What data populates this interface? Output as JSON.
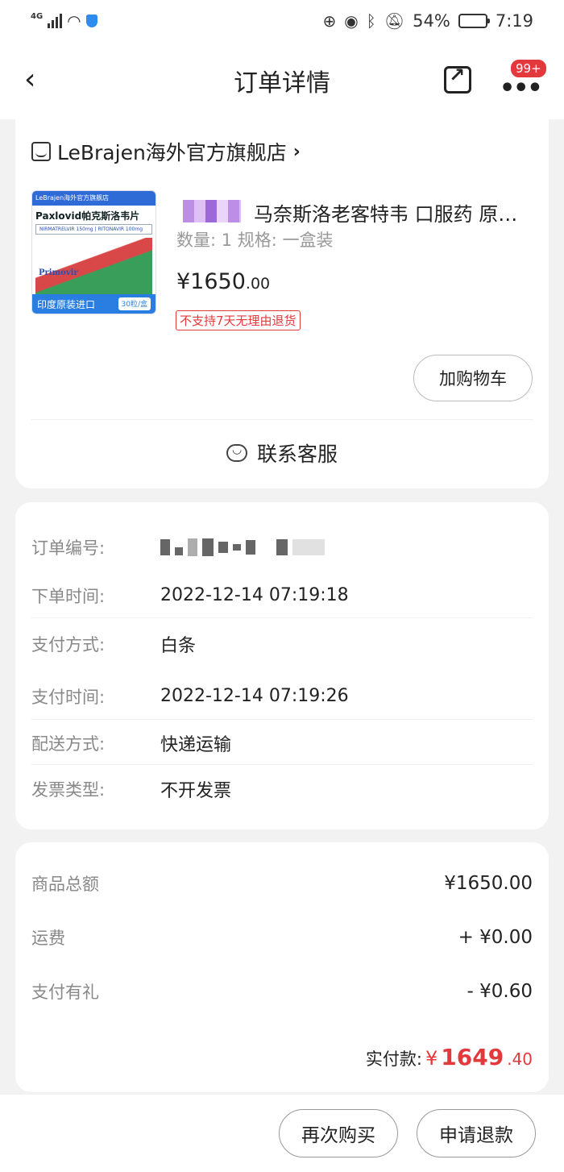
{
  "status_bar": {
    "network": "4G",
    "battery": "54%",
    "time": "7:19"
  },
  "nav": {
    "title": "订单详情",
    "badge": "99+"
  },
  "store": {
    "name": "LeBrajen海外官方旗舰店"
  },
  "product": {
    "image": {
      "top_label": "LeBrajen海外官方旗舰店",
      "name": "Paxlovid帕克斯洛韦片",
      "sub": "NIRMATRELVIR 150mg | RITONAVIR 100mg",
      "brand": "Primovir",
      "bottom": "印度原装进口",
      "qty": "30粒/盒"
    },
    "title": "马奈斯洛老客特韦 口服药 原装进口",
    "spec": "数量: 1  规格: 一盒装",
    "price_int": "¥1650",
    "price_dec": ".00",
    "return_tag": "不支持7天无理由退货",
    "cart_button": "加购物车"
  },
  "service": {
    "label": "联系客服"
  },
  "order_info": [
    {
      "label": "订单编号:",
      "value": ""
    },
    {
      "label": "下单时间:",
      "value": "2022-12-14 07:19:18"
    },
    {
      "label": "支付方式:",
      "value": "白条"
    },
    {
      "label": "支付时间:",
      "value": "2022-12-14 07:19:26"
    },
    {
      "label": "配送方式:",
      "value": "快递运输"
    },
    {
      "label": "发票类型:",
      "value": "不开发票"
    }
  ],
  "totals": [
    {
      "label": "商品总额",
      "value": "¥1650.00"
    },
    {
      "label": "运费",
      "value": "+ ¥0.00"
    },
    {
      "label": "支付有礼",
      "value": "- ¥0.60"
    }
  ],
  "paid": {
    "label": "实付款:",
    "currency": "¥",
    "int": "1649",
    "dec": ".40"
  },
  "bottom_buttons": {
    "rebuy": "再次购买",
    "refund": "申请退款"
  },
  "colors": {
    "accent": "#e4393c",
    "background": "#f2f2f2",
    "card": "#ffffff"
  }
}
